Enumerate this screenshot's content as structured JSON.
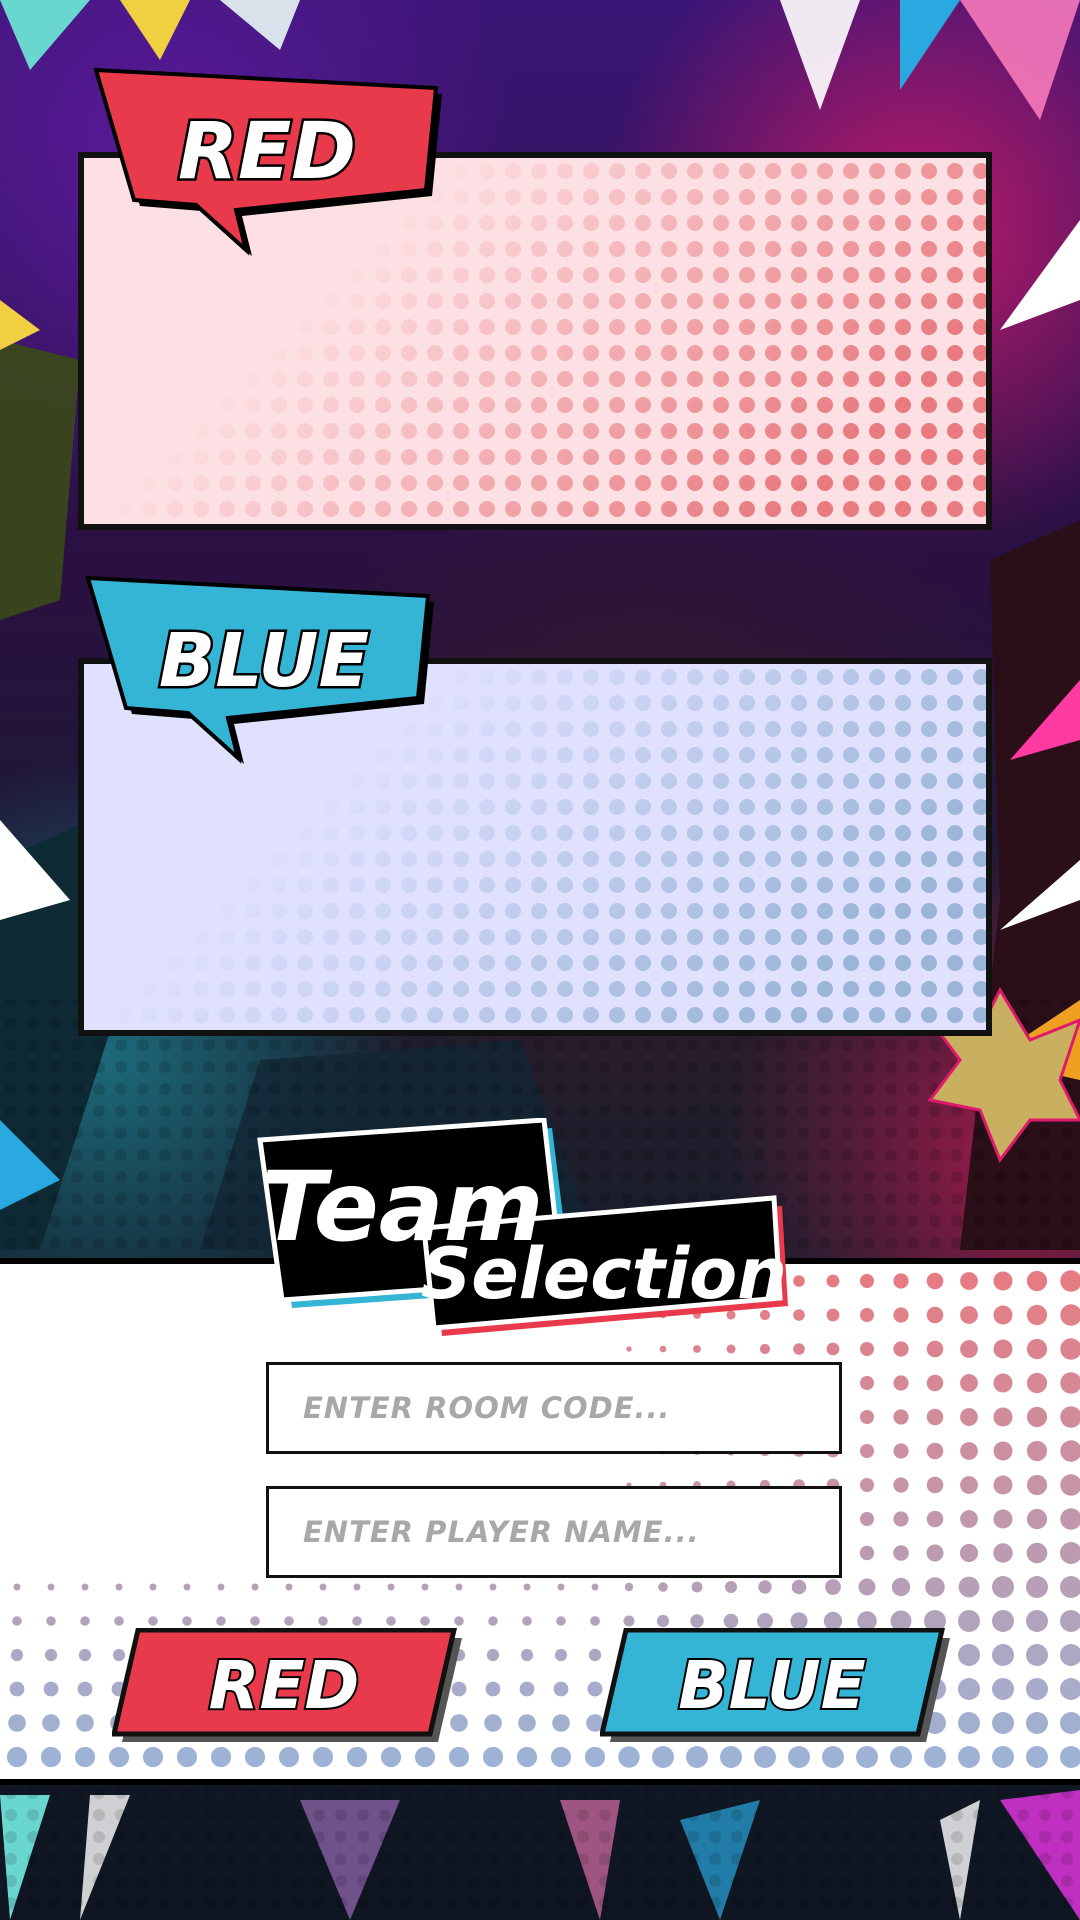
{
  "panels": {
    "red": {
      "badge_label": "RED",
      "color": "#e83a4a",
      "fill": "#fde0e3",
      "dot_color": "#e87a80"
    },
    "blue": {
      "badge_label": "BLUE",
      "color": "#35b5d6",
      "fill": "#e0e0ff",
      "dot_color": "#9ab5d8"
    }
  },
  "title": {
    "line1": "Team",
    "line2": "Selection"
  },
  "form": {
    "room_code": {
      "placeholder": "ENTER ROOM CODE...",
      "value": ""
    },
    "player_name": {
      "placeholder": "ENTER PLAYER NAME...",
      "value": ""
    }
  },
  "buttons": {
    "red": {
      "label": "RED",
      "color": "#e83a4a"
    },
    "blue": {
      "label": "BLUE",
      "color": "#35b5d6"
    }
  }
}
